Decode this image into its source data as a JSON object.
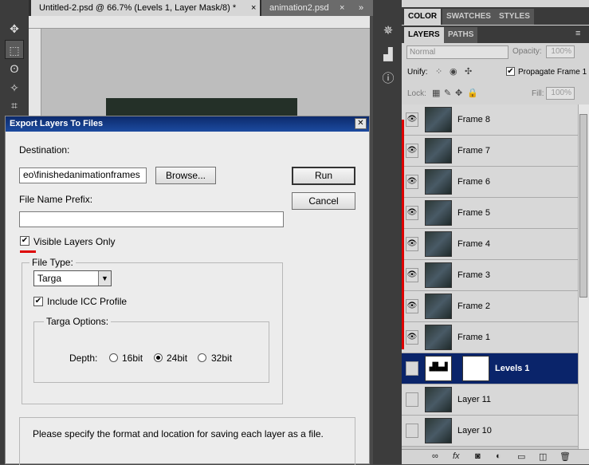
{
  "doc_tabs": {
    "active": "Untitled-2.psd @ 66.7% (Levels 1, Layer Mask/8) *",
    "inactive": "animation2.psd",
    "close_glyph": "×",
    "overflow_glyph": "»"
  },
  "dialog": {
    "title": "Export Layers To Files",
    "close_glyph": "✕",
    "destination_label": "Destination:",
    "destination_value": "eo\\finishedanimationframes",
    "browse_label": "Browse...",
    "run_label": "Run",
    "cancel_label": "Cancel",
    "prefix_label": "File Name Prefix:",
    "prefix_value": "",
    "visible_only_label": "Visible Layers Only",
    "visible_only_checked": true,
    "file_type_label": "File Type:",
    "file_type_value": "Targa",
    "icc_label": "Include ICC Profile",
    "icc_checked": true,
    "targa_options_label": "Targa Options:",
    "depth_label": "Depth:",
    "depth_options": [
      "16bit",
      "24bit",
      "32bit"
    ],
    "depth_selected": "24bit",
    "help_text": "Please specify the format and location for saving each layer as a file."
  },
  "panel": {
    "top_tabs": [
      "COLOR",
      "SWATCHES",
      "STYLES"
    ],
    "layer_tabs": [
      "LAYERS",
      "PATHS"
    ],
    "blend_mode": "Normal",
    "opacity_label": "Opacity:",
    "opacity_value": "100%",
    "unify_label": "Unify:",
    "propagate_label": "Propagate Frame 1",
    "propagate_checked": true,
    "lock_label": "Lock:",
    "fill_label": "Fill:",
    "fill_value": "100%",
    "layers": [
      {
        "name": "Frame 8",
        "visible": true,
        "selected": false
      },
      {
        "name": "Frame 7",
        "visible": true,
        "selected": false
      },
      {
        "name": "Frame 6",
        "visible": true,
        "selected": false
      },
      {
        "name": "Frame 5",
        "visible": true,
        "selected": false
      },
      {
        "name": "Frame 4",
        "visible": true,
        "selected": false
      },
      {
        "name": "Frame 3",
        "visible": true,
        "selected": false
      },
      {
        "name": "Frame 2",
        "visible": true,
        "selected": false
      },
      {
        "name": "Frame 1",
        "visible": true,
        "selected": false
      },
      {
        "name": "Levels 1",
        "visible": false,
        "selected": true
      },
      {
        "name": "Layer 11",
        "visible": false,
        "selected": false
      },
      {
        "name": "Layer 10",
        "visible": false,
        "selected": false
      }
    ]
  },
  "colors": {
    "selection": "#0a246a",
    "title_bar": "#0c2a6c",
    "marker_red": "#dd0000"
  }
}
